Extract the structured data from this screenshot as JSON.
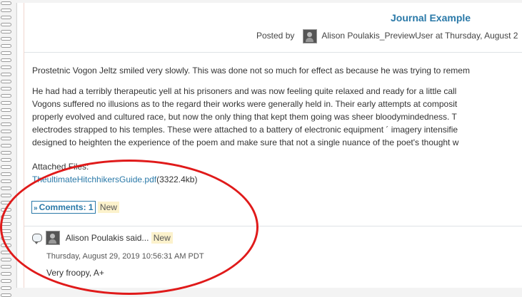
{
  "journal": {
    "title": "Journal Example",
    "posted_by_label": "Posted by",
    "author": "Alison Poulakis_PreviewUser",
    "posted_at": "at Thursday, August 2"
  },
  "entry": {
    "paragraphs": [
      "Prostetnic Vogon Jeltz smiled very slowly. This was done not so  much for effect as because he was trying to remem",
      "He had had a terribly therapeutic yell at his  prisoners and was now feeling quite relaxed and ready for a little  call",
      " Vogons suffered no illusions as to the regard their works were  generally held in. Their early attempts at composit",
      "properly evolved  and cultured race, but now the only thing that kept them going was  sheer bloodymindedness.  T",
      "electrodes strapped to his temples. These were attached to a  battery of electronic equipment ´ imagery intensifie",
      "designed  to heighten the experience of the poem and make sure that not a  single nuance of the poet's thought w"
    ],
    "attached_label": "Attached Files:",
    "attachment_name": "TheultimateHitchhikersGuide.pdf",
    "attachment_size": "(3322.4kb)"
  },
  "comments": {
    "toggle_label": "Comments: 1",
    "toggle_icon": "double-chevron-up-icon",
    "new_badge": "New",
    "items": [
      {
        "author": "Alison Poulakis said...",
        "new_badge": "New",
        "timestamp": "Thursday, August 29, 2019 10:56:31 AM PDT",
        "text": "Very froopy, A+"
      }
    ]
  },
  "colors": {
    "link": "#2a79a8",
    "new_badge_bg": "#fcf2cc",
    "annotation": "#e01a1a"
  }
}
